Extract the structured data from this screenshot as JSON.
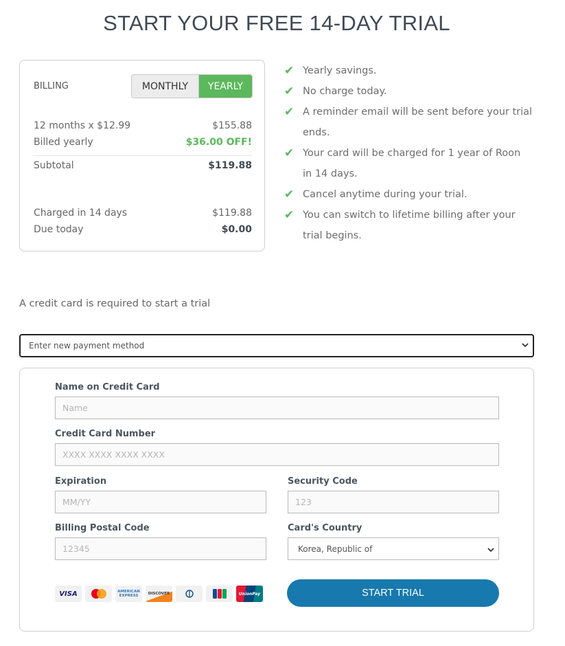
{
  "page": {
    "title": "START YOUR FREE 14-DAY TRIAL"
  },
  "billing": {
    "label": "BILLING",
    "toggle": {
      "monthly": "MONTHLY",
      "yearly": "YEARLY",
      "selected": "yearly"
    },
    "rows": [
      {
        "label": "12 months x $12.99",
        "value": "$155.88"
      },
      {
        "label": "Billed yearly",
        "value": "$36.00 OFF!"
      },
      {
        "label": "Subtotal",
        "value": "$119.88"
      },
      {
        "label": "Charged in 14 days",
        "value": "$119.88"
      },
      {
        "label": "Due today",
        "value": "$0.00"
      }
    ]
  },
  "benefits": [
    {
      "line1": "Yearly savings.",
      "line2": ""
    },
    {
      "line1": "No charge today.",
      "line2": ""
    },
    {
      "line1": "A reminder email will be sent before your trial",
      "line2": "ends."
    },
    {
      "line1": "Your card will be charged for 1 year of Roon",
      "line2": "in 14 days."
    },
    {
      "line1": "Cancel anytime during your trial.",
      "line2": ""
    },
    {
      "line1": "You can switch to lifetime billing after your",
      "line2": "trial begins."
    }
  ],
  "credit_note": "A credit card is required to start a trial",
  "payment_method": {
    "selected": "Enter new payment method"
  },
  "form": {
    "name": {
      "label": "Name on Credit Card",
      "placeholder": "Name"
    },
    "number": {
      "label": "Credit Card Number",
      "placeholder": "XXXX XXXX XXXX XXXX"
    },
    "expiration": {
      "label": "Expiration",
      "placeholder": "MM/YY"
    },
    "security": {
      "label": "Security Code",
      "placeholder": "123"
    },
    "postal": {
      "label": "Billing Postal Code",
      "placeholder": "12345"
    },
    "country": {
      "label": "Card's Country",
      "selected": "Korea, Republic of"
    },
    "card_brands": [
      "VISA",
      "MasterCard",
      "AMERICAN EXPRESS",
      "DISCOVER",
      "Diners Club",
      "JCB",
      "UnionPay"
    ],
    "submit_label": "START TRIAL"
  },
  "colors": {
    "accent_green": "#5cb85c",
    "primary_blue": "#1779ad"
  }
}
